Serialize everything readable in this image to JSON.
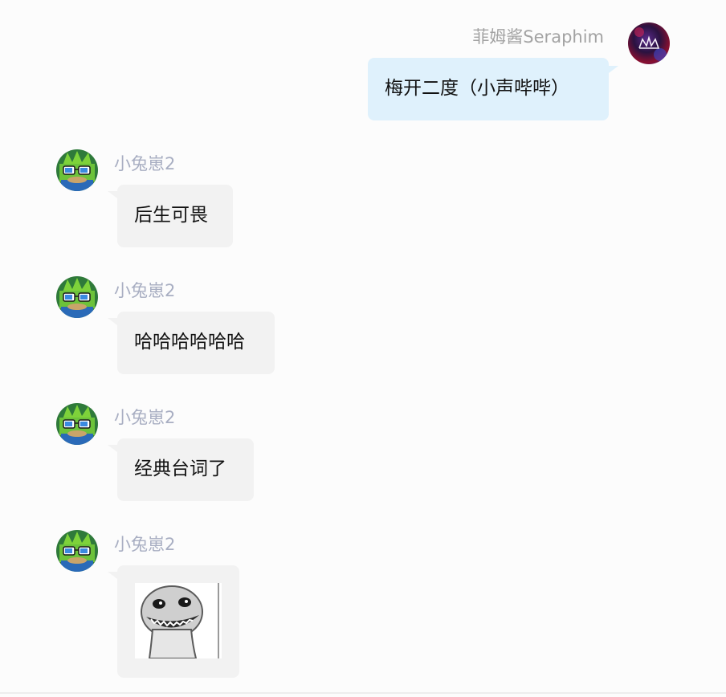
{
  "self": {
    "name": "菲姆酱Seraphim",
    "avatar_icon": "crown-avatar-icon"
  },
  "messages": [
    {
      "sender": "菲姆酱Seraphim",
      "side": "right",
      "type": "text",
      "text": "梅开二度（小声哔哔）"
    },
    {
      "sender": "小兔崽2",
      "side": "left",
      "type": "text",
      "text": "后生可畏"
    },
    {
      "sender": "小兔崽2",
      "side": "left",
      "type": "text",
      "text": "哈哈哈哈哈哈"
    },
    {
      "sender": "小兔崽2",
      "side": "left",
      "type": "text",
      "text": "经典台词了"
    },
    {
      "sender": "小兔崽2",
      "side": "left",
      "type": "sticker",
      "sticker_icon": "grinning-face-sticker-icon"
    }
  ],
  "colors": {
    "background": "#fcfcfc",
    "own_bubble": "#dff1fc",
    "other_bubble": "#f2f2f2",
    "other_name": "#a8aec2",
    "own_name": "#a3a3a3"
  }
}
